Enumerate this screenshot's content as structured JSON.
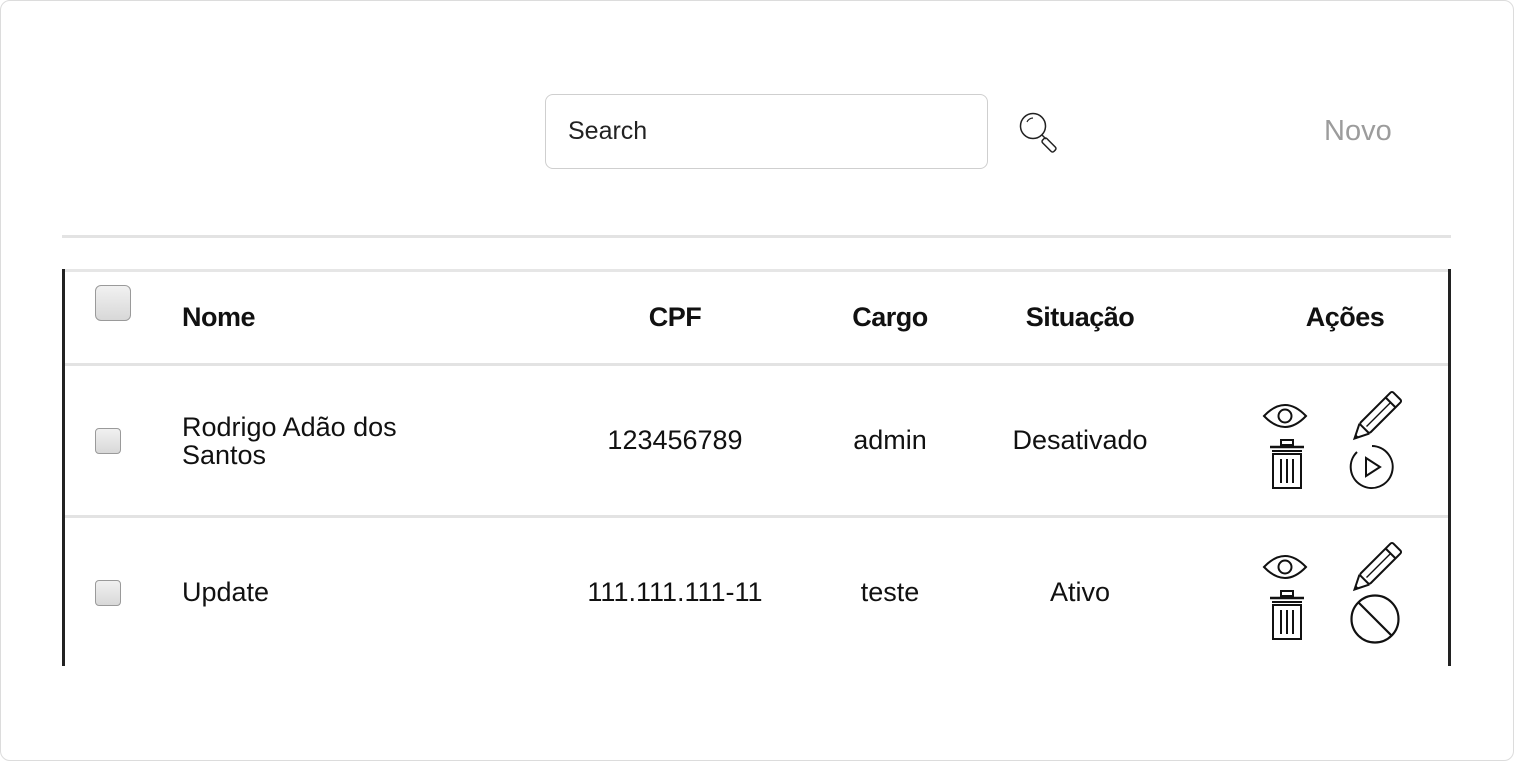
{
  "search": {
    "placeholder": "Search"
  },
  "toolbar": {
    "new_label": "Novo"
  },
  "table": {
    "headers": {
      "nome": "Nome",
      "cpf": "CPF",
      "cargo": "Cargo",
      "situacao": "Situação",
      "acoes": "Ações"
    },
    "rows": [
      {
        "nome": "Rodrigo Adão dos Santos",
        "cpf": "123456789",
        "cargo": "admin",
        "situacao": "Desativado",
        "toggle_icon": "play-circle-icon"
      },
      {
        "nome": "Update",
        "cpf": "111.111.111-11",
        "cargo": "teste",
        "situacao": "Ativo",
        "toggle_icon": "block-icon"
      }
    ]
  },
  "icons": {
    "search": "search-icon",
    "view": "eye-icon",
    "edit": "pencil-icon",
    "delete": "trash-icon"
  }
}
